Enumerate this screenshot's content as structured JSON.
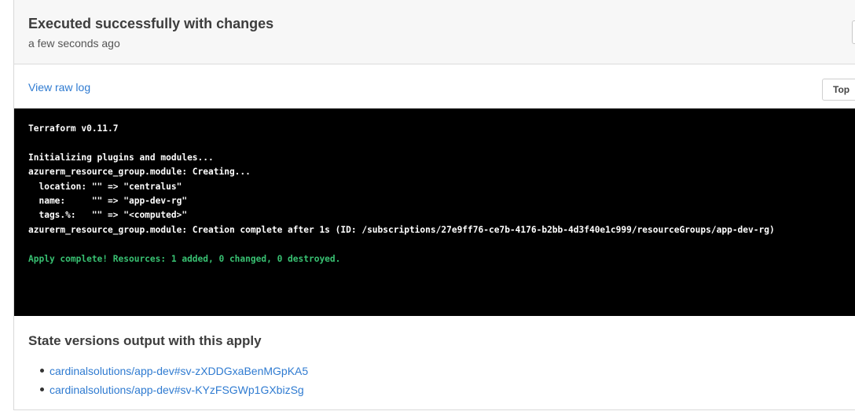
{
  "run": {
    "status_title": "Executed successfully with changes",
    "time_ago": "a few seconds ago"
  },
  "log": {
    "view_raw_label": "View raw log",
    "top_button_label": "Top",
    "lines": [
      {
        "text": "Terraform v0.11.7",
        "kind": "normal"
      },
      {
        "text": "",
        "kind": "normal"
      },
      {
        "text": "Initializing plugins and modules...",
        "kind": "normal"
      },
      {
        "text": "azurerm_resource_group.module: Creating...",
        "kind": "normal"
      },
      {
        "text": "  location: \"\" => \"centralus\"",
        "kind": "normal"
      },
      {
        "text": "  name:     \"\" => \"app-dev-rg\"",
        "kind": "normal"
      },
      {
        "text": "  tags.%:   \"\" => \"<computed>\"",
        "kind": "normal"
      },
      {
        "text": "azurerm_resource_group.module: Creation complete after 1s (ID: /subscriptions/27e9ff76-ce7b-4176-b2bb-4d3f40e1c999/resourceGroups/app-dev-rg)",
        "kind": "normal"
      },
      {
        "text": "",
        "kind": "normal"
      },
      {
        "text": "Apply complete! Resources: 1 added, 0 changed, 0 destroyed.",
        "kind": "success"
      }
    ]
  },
  "state_versions": {
    "title": "State versions output with this apply",
    "items": [
      {
        "label": "cardinalsolutions/app-dev#sv-zXDDGxaBenMGpKA5"
      },
      {
        "label": "cardinalsolutions/app-dev#sv-KYzFSGWp1GXbizSg"
      }
    ]
  },
  "colors": {
    "link": "#2f7bd1",
    "terminal_bg": "#000000",
    "terminal_text": "#ffffff",
    "terminal_success": "#38c172",
    "header_bg": "#f7f7f7"
  }
}
